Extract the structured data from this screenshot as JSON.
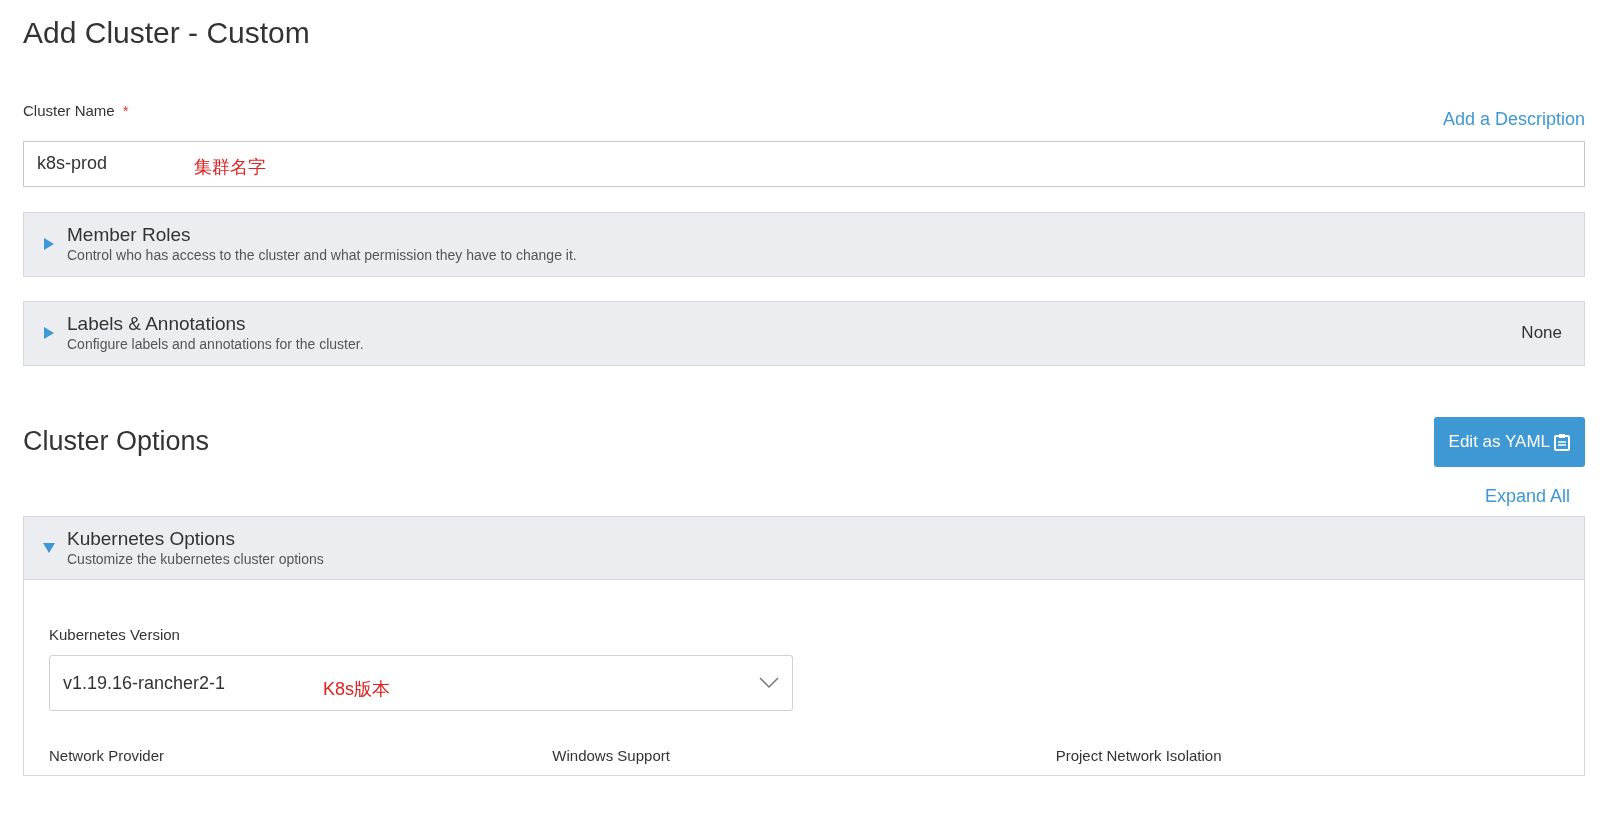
{
  "title": "Add Cluster - Custom",
  "cluster_name": {
    "label": "Cluster Name",
    "required_mark": "*",
    "add_description": "Add a Description",
    "value": "k8s-prod",
    "annotation": "集群名字"
  },
  "panels": [
    {
      "title": "Member Roles",
      "subtitle": "Control who has access to the cluster and what permission they have to change it.",
      "expanded": false
    },
    {
      "title": "Labels & Annotations",
      "subtitle": "Configure labels and annotations for the cluster.",
      "expanded": false,
      "status": "None"
    }
  ],
  "cluster_options": {
    "heading": "Cluster Options",
    "yaml_button": "Edit as YAML",
    "expand_all": "Expand All",
    "kubernetes_options": {
      "title": "Kubernetes Options",
      "subtitle": "Customize the kubernetes cluster options",
      "expanded": true,
      "version_label": "Kubernetes Version",
      "version_value": "v1.19.16-rancher2-1",
      "version_annotation": "K8s版本",
      "bottom_labels": [
        "Network Provider",
        "Windows Support",
        "Project Network Isolation"
      ]
    }
  }
}
